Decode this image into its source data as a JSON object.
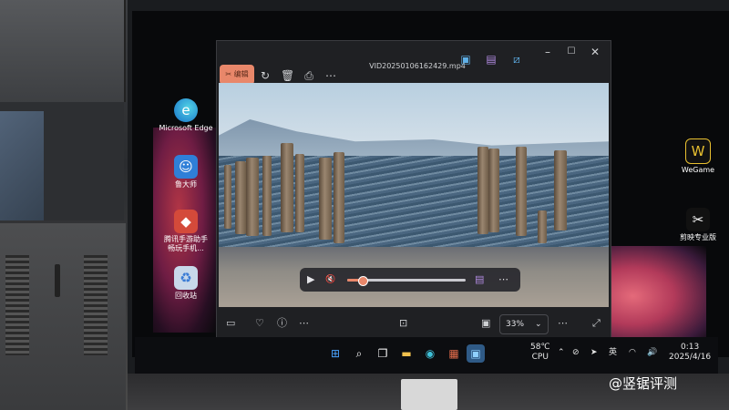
{
  "desktop": {
    "icons_left": [
      {
        "label": "Microsoft Edge",
        "icon": "edge-icon"
      },
      {
        "label": "鲁大师",
        "icon": "ludashi-icon"
      },
      {
        "label": "腾讯手游助手\n畅玩手机...",
        "icon": "tencent-game-assistant-icon"
      },
      {
        "label": "回收站",
        "icon": "recycle-bin-icon"
      }
    ],
    "icons_right": [
      {
        "label": "WeGame",
        "icon": "wegame-icon"
      },
      {
        "label": "剪映专业版",
        "icon": "capcut-icon"
      }
    ]
  },
  "viewer": {
    "title": "VID20250106162429.mp4",
    "edit_label": "编辑",
    "progress_percent": 12,
    "zoom_value": "33%",
    "colors": {
      "accent": "#e8876a",
      "window_bg": "#1f2023"
    }
  },
  "taskbar": {
    "weather_temp": "58℃",
    "weather_label": "CPU",
    "input_method": "英",
    "time": "0:13",
    "date": "2025/4/16"
  },
  "watermark": "@竖锯评测"
}
